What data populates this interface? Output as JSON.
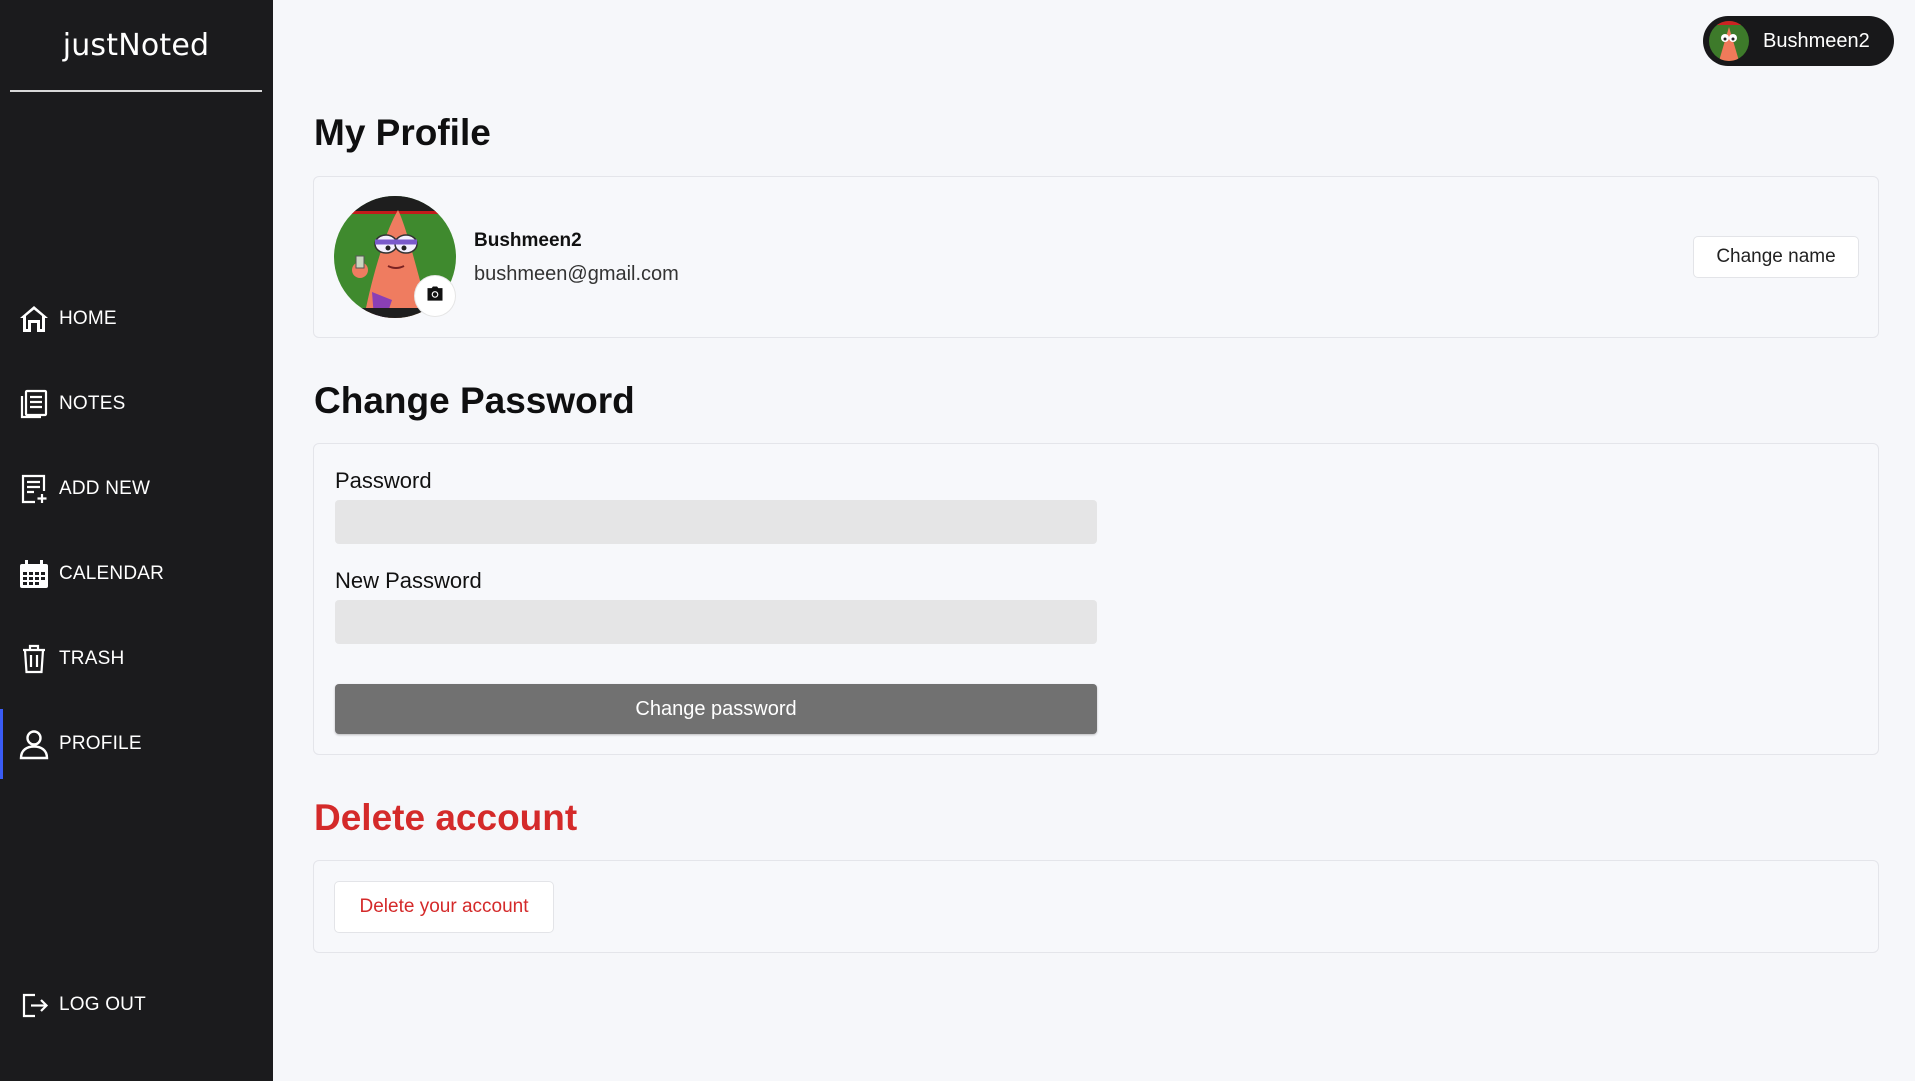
{
  "app": {
    "brand": "justNoted"
  },
  "sidebar": {
    "items": [
      {
        "label": "HOME",
        "icon": "home-icon"
      },
      {
        "label": "NOTES",
        "icon": "notes-icon"
      },
      {
        "label": "ADD NEW",
        "icon": "add-note-icon"
      },
      {
        "label": "CALENDAR",
        "icon": "calendar-icon"
      },
      {
        "label": "TRASH",
        "icon": "trash-icon"
      },
      {
        "label": "PROFILE",
        "icon": "user-icon",
        "active": true
      }
    ],
    "logout": {
      "label": "LOG OUT",
      "icon": "logout-icon"
    }
  },
  "header": {
    "username": "Bushmeen2"
  },
  "profile": {
    "title": "My Profile",
    "name": "Bushmeen2",
    "email": "bushmeen@gmail.com",
    "change_name_label": "Change name"
  },
  "password": {
    "title": "Change Password",
    "password_label": "Password",
    "password_value": "",
    "new_password_label": "New Password",
    "new_password_value": "",
    "submit_label": "Change password"
  },
  "delete": {
    "title": "Delete account",
    "button_label": "Delete your account"
  },
  "colors": {
    "sidebar_bg": "#1b1b1d",
    "active_accent": "#3a5cf5",
    "danger": "#d42a2a",
    "primary_button": "#717171"
  }
}
